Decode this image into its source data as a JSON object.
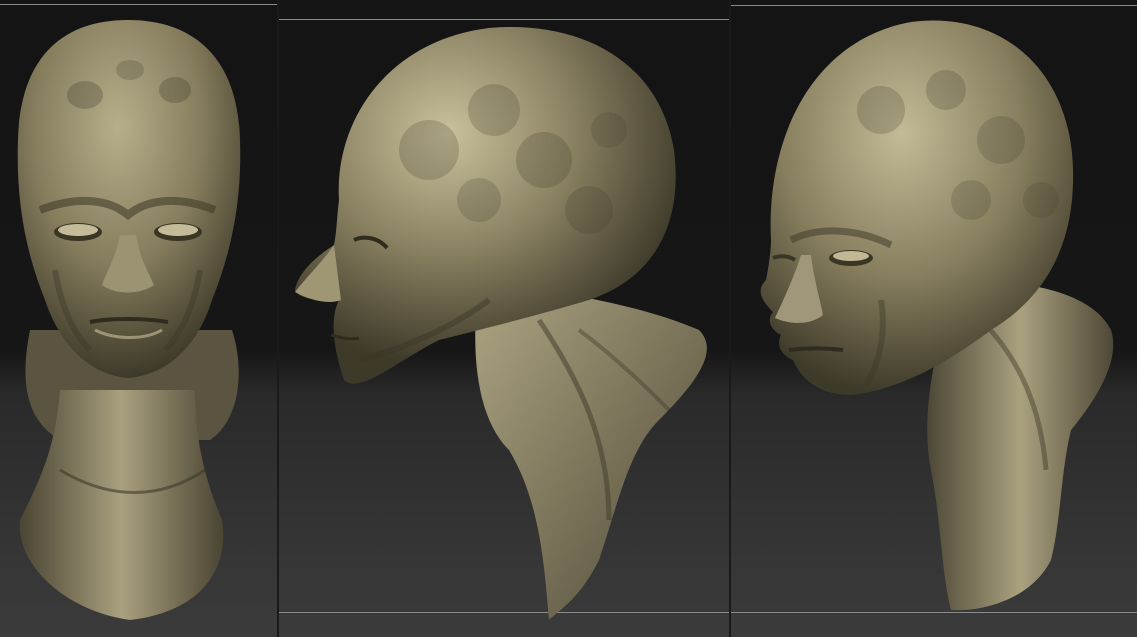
{
  "image": {
    "views": [
      {
        "name": "front",
        "kind": "sculpt-render-front"
      },
      {
        "name": "side",
        "kind": "sculpt-render-profile"
      },
      {
        "name": "three-quarter",
        "kind": "sculpt-render-three-quarter"
      }
    ],
    "colors": {
      "background_top": "#141414",
      "background_bottom": "#3b3b3b",
      "clay_light": "#cfc8a6",
      "clay_mid": "#8a8160",
      "clay_dark": "#3c3828",
      "rule": "#8a8a8a"
    }
  }
}
